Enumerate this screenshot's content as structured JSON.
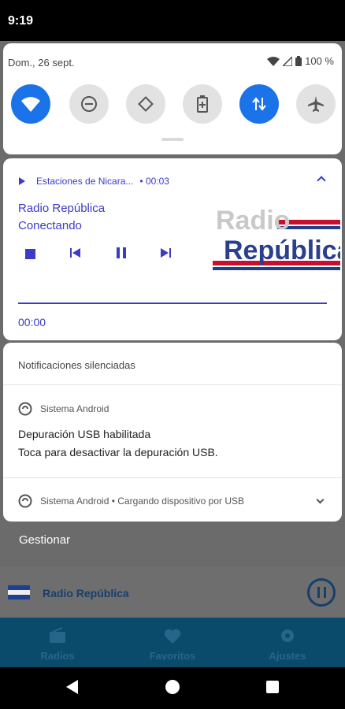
{
  "status_bar": {
    "time": "9:19"
  },
  "quick_settings": {
    "date": "Dom., 26 sept.",
    "battery": "100 %",
    "tiles": [
      {
        "name": "wifi",
        "active": true
      },
      {
        "name": "do-not-disturb",
        "active": false
      },
      {
        "name": "auto-rotate",
        "active": false
      },
      {
        "name": "battery-saver",
        "active": false
      },
      {
        "name": "mobile-data",
        "active": true
      },
      {
        "name": "airplane-mode",
        "active": false
      }
    ]
  },
  "media": {
    "source": "Estaciones de Nicara...",
    "elapsed_header": "• 00:03",
    "title": "Radio República",
    "subtitle": "Conectando",
    "art_text_1": "Radio",
    "art_text_2": "República",
    "time": "00:00",
    "accent": "#3b3bc8"
  },
  "silent": {
    "header": "Notificaciones silenciadas",
    "n1_app": "Sistema Android",
    "n1_title": "Depuración USB habilitada",
    "n1_text": "Toca para desactivar la depuración USB.",
    "n2_app": "Sistema Android • Cargando dispositivo por USB"
  },
  "manage": "Gestionar",
  "background_app": {
    "station": "Radio República",
    "tabs": [
      "Radios",
      "Favoritos",
      "Ajustes"
    ]
  }
}
